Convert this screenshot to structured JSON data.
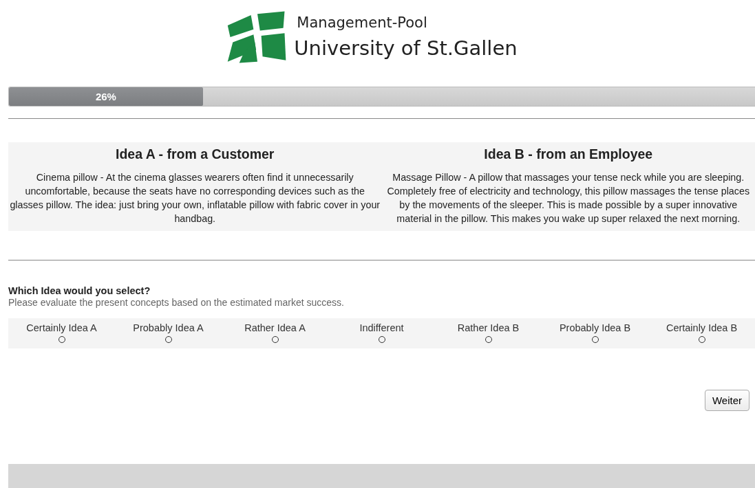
{
  "header": {
    "subtitle": "Management-Pool",
    "title": "University of St.Gallen"
  },
  "progress": {
    "label": "26%",
    "level": 0.26
  },
  "ideas": [
    {
      "title": "Idea A - from a Customer",
      "text": "Cinema pillow - At the cinema glasses wearers often find it unnecessarily uncomfortable, because the seats have no corresponding devices such as the glasses pillow. The idea: just bring your own, inflatable pillow with fabric cover in your handbag."
    },
    {
      "title": "Idea B - from an Employee",
      "text": "Massage Pillow - A pillow that massages your tense neck while you are sleeping. Completely free of electricity and technology, this pillow massages the tense places by the movements of the sleeper. This is made possible by a super innovative material in the pillow. This makes you wake up super relaxed the next morning."
    }
  ],
  "question": {
    "title": "Which Idea would you select?",
    "hint": "Please evaluate the present concepts based on the estimated market success.",
    "options": [
      {
        "label": "Certainly Idea A",
        "selected": false
      },
      {
        "label": "Probably Idea A",
        "selected": false
      },
      {
        "label": "Rather Idea A",
        "selected": false
      },
      {
        "label": "Indifferent",
        "selected": false
      },
      {
        "label": "Rather Idea B",
        "selected": false
      },
      {
        "label": "Probably Idea B",
        "selected": false
      },
      {
        "label": "Certainly Idea B",
        "selected": false
      }
    ]
  },
  "next_button": "Weiter"
}
